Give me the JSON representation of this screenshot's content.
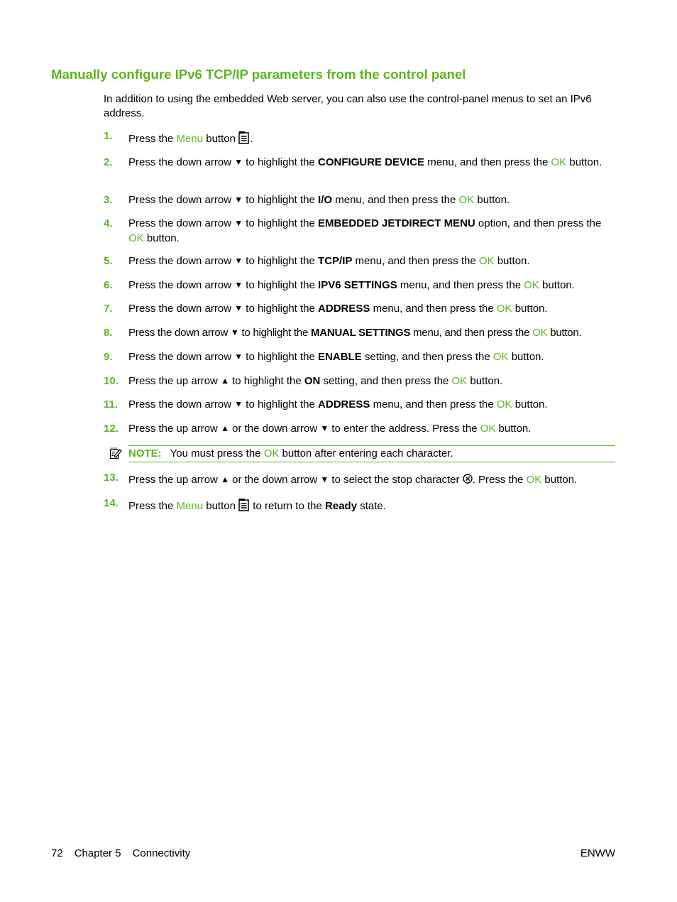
{
  "heading": "Manually configure IPv6 TCP/IP parameters from the control panel",
  "intro": "In addition to using the embedded Web server, you can also use the control-panel menus to set an IPv6 address.",
  "colors": {
    "accent": "#5bb51f",
    "text": "#000000"
  },
  "words": {
    "press_the": "Press the",
    "menu": "Menu",
    "ok": "OK",
    "button": "button",
    "button_period": "button."
  },
  "steps": [
    {
      "num": "1.",
      "parts": [
        "Press the ",
        "Menu",
        " button",
        "."
      ]
    },
    {
      "num": "2.",
      "a": "Press the down arrow ",
      "b": " to highlight the ",
      "bold": "CONFIGURE DEVICE",
      "c": " menu, and then press the ",
      "ok": "OK",
      "d": " button."
    },
    {
      "num": "3.",
      "a": "Press the down arrow ",
      "b": " to highlight the ",
      "bold": "I/O",
      "c": " menu, and then press the ",
      "ok": "OK",
      "d": " button."
    },
    {
      "num": "4.",
      "a": "Press the down arrow ",
      "b": " to highlight the ",
      "bold": "EMBEDDED JETDIRECT MENU",
      "c": " option, and then press the ",
      "ok": "OK",
      "d": " button."
    },
    {
      "num": "5.",
      "a": "Press the down arrow ",
      "b": " to highlight the ",
      "bold": "TCP/IP",
      "c": " menu, and then press the ",
      "ok": "OK",
      "d": " button."
    },
    {
      "num": "6.",
      "a": "Press the down arrow ",
      "b": " to highlight the ",
      "bold": "IPV6 SETTINGS",
      "c": " menu, and then press the ",
      "ok": "OK",
      "d": " button."
    },
    {
      "num": "7.",
      "a": "Press the down arrow ",
      "b": " to highlight the ",
      "bold": "ADDRESS",
      "c": " menu, and then press the ",
      "ok": "OK",
      "d": " button."
    },
    {
      "num": "8.",
      "a": "Press the down arrow ",
      "b": " to highlight the ",
      "bold": "MANUAL SETTINGS",
      "c": " menu, and then press the ",
      "ok": "OK",
      "d": " button."
    },
    {
      "num": "9.",
      "a": "Press the down arrow ",
      "b": " to highlight the ",
      "bold": "ENABLE",
      "c": " setting, and then press the ",
      "ok": "OK",
      "d": " button."
    },
    {
      "num": "10.",
      "a": "Press the up arrow ",
      "b": " to highlight the ",
      "bold": "ON",
      "c": " setting, and then press the ",
      "ok": "OK",
      "d": " button."
    },
    {
      "num": "11.",
      "a": "Press the down arrow ",
      "b": " to highlight the ",
      "bold": "ADDRESS",
      "c": " menu, and then press the ",
      "ok": "OK",
      "d": " button."
    },
    {
      "num": "12.",
      "a": "Press the up arrow ",
      "b": " or the down arrow ",
      "c": " to enter the address. Press the ",
      "ok": "OK",
      "d": " button."
    },
    {
      "num": "13.",
      "a": "Press the up arrow ",
      "b": " or the down arrow ",
      "c": " to select the stop character ",
      "c2": ". Press the ",
      "ok": "OK",
      "d": " button."
    },
    {
      "num": "14.",
      "a": "Press the ",
      "menu": "Menu",
      "b": " button ",
      "c": " to return to the ",
      "bold": "Ready",
      "d": " state."
    }
  ],
  "arrows": {
    "down": "▼",
    "up": "▲"
  },
  "note": {
    "label": "NOTE:",
    "a": "You must press the ",
    "ok": "OK",
    "b": " button after entering each character."
  },
  "footer": {
    "page": "72",
    "chapter": "Chapter 5",
    "section": "Connectivity",
    "right": "ENWW"
  }
}
